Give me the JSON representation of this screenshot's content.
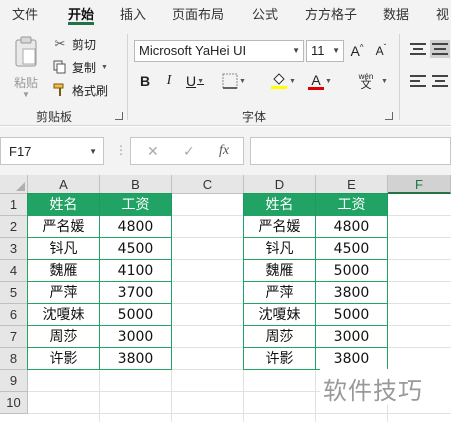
{
  "ribbon_tabs": [
    "文件",
    "开始",
    "插入",
    "页面布局",
    "公式",
    "方方格子",
    "数据",
    "视"
  ],
  "clipboard": {
    "paste": "粘贴",
    "cut": "剪切",
    "copy": "复制",
    "format_painter": "格式刷",
    "group_label": "剪贴板"
  },
  "font": {
    "family": "Microsoft YaHei UI",
    "size": "11",
    "group_label": "字体",
    "grow": "A",
    "shrink": "A",
    "bold": "B",
    "italic": "I",
    "underline": "U",
    "font_color": "A",
    "phonetic_top": "wén",
    "phonetic_bottom": "文",
    "highlight_color": "#ffff00",
    "font_color_value": "#e00000"
  },
  "formula_bar": {
    "name_box": "F17",
    "fx": "fx",
    "value": ""
  },
  "columns": [
    "A",
    "B",
    "C",
    "D",
    "E",
    "F"
  ],
  "selected_column": "F",
  "rows": [
    "1",
    "2",
    "3",
    "4",
    "5",
    "6",
    "7",
    "8",
    "9",
    "10"
  ],
  "table_left": {
    "headers": [
      "姓名",
      "工资"
    ],
    "rows": [
      [
        "严名媛",
        "4800"
      ],
      [
        "钭凡",
        "4500"
      ],
      [
        "魏雁",
        "4100"
      ],
      [
        "严萍",
        "3700"
      ],
      [
        "沈嗄妹",
        "5000"
      ],
      [
        "周莎",
        "3000"
      ],
      [
        "许影",
        "3800"
      ]
    ]
  },
  "table_right": {
    "headers": [
      "姓名",
      "工资"
    ],
    "rows": [
      [
        "严名媛",
        "4800"
      ],
      [
        "钭凡",
        "4500"
      ],
      [
        "魏雁",
        "5000"
      ],
      [
        "严萍",
        "3800"
      ],
      [
        "沈嗄妹",
        "5000"
      ],
      [
        "周莎",
        "3000"
      ],
      [
        "许影",
        "3800"
      ]
    ]
  },
  "watermark": "软件技巧",
  "colors": {
    "accent": "#217346",
    "table_header": "#21a366"
  }
}
